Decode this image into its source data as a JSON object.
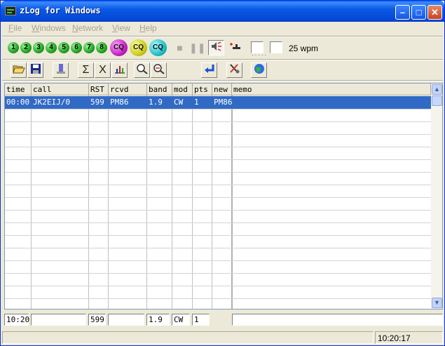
{
  "window": {
    "title": "zLog for Windows"
  },
  "menu": [
    {
      "label": "File",
      "mnemonic": "F",
      "rest": "ile"
    },
    {
      "label": "Windows",
      "mnemonic": "W",
      "rest": "indows"
    },
    {
      "label": "Network",
      "mnemonic": "N",
      "rest": "etwork"
    },
    {
      "label": "View",
      "mnemonic": "V",
      "rest": "iew"
    },
    {
      "label": "Help",
      "mnemonic": "H",
      "rest": "elp"
    }
  ],
  "cw_buttons": [
    "1",
    "2",
    "3",
    "4",
    "5",
    "6",
    "7",
    "8"
  ],
  "cq_buttons": [
    "CQ",
    "CQ",
    "CQ"
  ],
  "speed": {
    "label": "25 wpm"
  },
  "table": {
    "headers": [
      "time",
      "call",
      "RST",
      "rcvd",
      "band",
      "mod",
      "pts",
      "new",
      "memo"
    ],
    "rows": [
      [
        "00:00",
        "JK2EIJ/0",
        "599",
        "PM86",
        "1.9",
        "CW",
        "1",
        "PM86",
        ""
      ]
    ]
  },
  "entry": {
    "time": "10:20",
    "call": "",
    "rst": "599",
    "rcvd": "",
    "band": "1.9",
    "mode": "CW",
    "pts": "1",
    "memo": ""
  },
  "status": {
    "message": "",
    "clock": "10:20:17"
  },
  "colors": {
    "selection": "#316ac5",
    "titlebar": "#0a5ae6"
  },
  "icons": {
    "toolbar1": [
      "cw-send-icon",
      "stop-icon",
      "pause-icon",
      "speaker-icon",
      "key-tune-icon"
    ],
    "toolbar2": [
      "open-folder-icon",
      "save-icon",
      "edit-icon",
      "sigma-icon",
      "delete-icon",
      "chart-icon",
      "find-icon",
      "find-next-icon",
      "enter-icon",
      "settings-icon",
      "globe-icon"
    ]
  }
}
